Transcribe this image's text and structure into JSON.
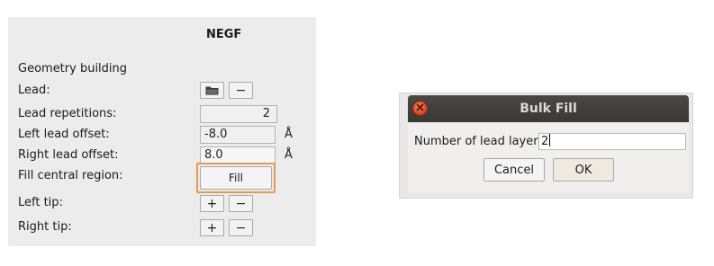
{
  "negf_panel": {
    "title": "NEGF",
    "section_heading": "Geometry building",
    "lead": {
      "label": "Lead:",
      "icons": [
        "folder-icon",
        "minus-icon"
      ]
    },
    "lead_repetitions": {
      "label": "Lead repetitions:",
      "value": "2"
    },
    "left_lead_offset": {
      "label": "Left lead offset:",
      "value": "-8.0",
      "unit": "Å"
    },
    "right_lead_offset": {
      "label": "Right lead offset:",
      "value": "8.0",
      "unit": "Å"
    },
    "fill_central_region": {
      "label": "Fill central region:",
      "button_label": "Fill"
    },
    "left_tip": {
      "label": "Left tip:",
      "icons": [
        "plus-icon",
        "minus-icon"
      ]
    },
    "right_tip": {
      "label": "Right tip:",
      "icons": [
        "plus-icon",
        "minus-icon"
      ]
    }
  },
  "bulk_fill_dialog": {
    "title": "Bulk Fill",
    "field_label": "Number of lead layers:",
    "field_value": "2",
    "cancel_label": "Cancel",
    "ok_label": "OK"
  },
  "colors": {
    "panel_bg": "#ececec",
    "focus_ring": "#e59a52",
    "titlebar": "#3f3d3a",
    "close_button": "#e0552d"
  }
}
